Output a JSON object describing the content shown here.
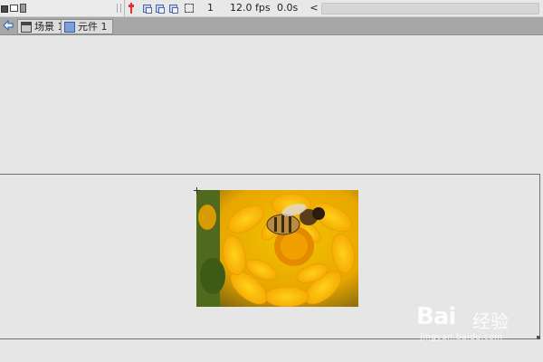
{
  "timeline": {
    "frame_number": "1",
    "fps": "12.0 fps",
    "elapsed_time": "0.0s",
    "scroll_left_glyph": "<",
    "icons": [
      "folder-icon",
      "new-layer-icon",
      "trash-icon",
      "playhead-icon",
      "onion-skin-icon",
      "onion-outline-icon",
      "edit-multiple-frames-icon",
      "marker-range-icon"
    ]
  },
  "edit_bar": {
    "breadcrumbs": [
      {
        "label": "场景 1",
        "icon": "clapper-icon"
      },
      {
        "label": "元件 1",
        "icon": "symbol-icon"
      }
    ]
  },
  "stage": {
    "content": "photo-bee-on-yellow-flower"
  },
  "watermark": {
    "logo": "Bai",
    "text": "经验",
    "url": "jingyan.baidu.com"
  },
  "colors": {
    "workspace": "#e6e6e6",
    "edit_bar": "#a7a7a7",
    "playhead": "#e33030",
    "flower": "#f7b500"
  }
}
